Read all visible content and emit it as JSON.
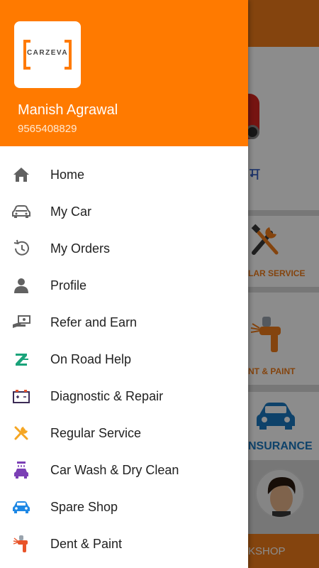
{
  "drawer": {
    "logo_text": "CARZEVA",
    "user_name": "Manish Agrawal",
    "user_phone": "9565408829",
    "items": [
      {
        "label": "Home",
        "icon": "home-icon"
      },
      {
        "label": "My Car",
        "icon": "car-icon"
      },
      {
        "label": "My Orders",
        "icon": "history-icon"
      },
      {
        "label": "Profile",
        "icon": "person-icon"
      },
      {
        "label": "Refer and Earn",
        "icon": "cash-hand-icon"
      },
      {
        "label": "On Road Help",
        "icon": "z-brand-icon"
      },
      {
        "label": "Diagnostic & Repair",
        "icon": "battery-icon"
      },
      {
        "label": "Regular Service",
        "icon": "tools-icon"
      },
      {
        "label": "Car Wash & Dry Clean",
        "icon": "car-wash-icon"
      },
      {
        "label": "Spare Shop",
        "icon": "spare-car-icon"
      },
      {
        "label": "Dent & Paint",
        "icon": "spray-gun-icon"
      }
    ]
  },
  "background": {
    "banner_text": "म",
    "cards": [
      {
        "label": "LAR SERVICE"
      },
      {
        "label": "NT & PAINT"
      },
      {
        "label": "NSURANCE"
      }
    ],
    "bottom_text": "KSHOP"
  },
  "colors": {
    "accent": "#ff7a00",
    "icon_gray": "#616161",
    "icon_green": "#1aa37a",
    "icon_orange": "#f5a623",
    "icon_purple": "#7b3fb5",
    "icon_blue": "#1e88e5",
    "icon_red": "#e8542a"
  }
}
